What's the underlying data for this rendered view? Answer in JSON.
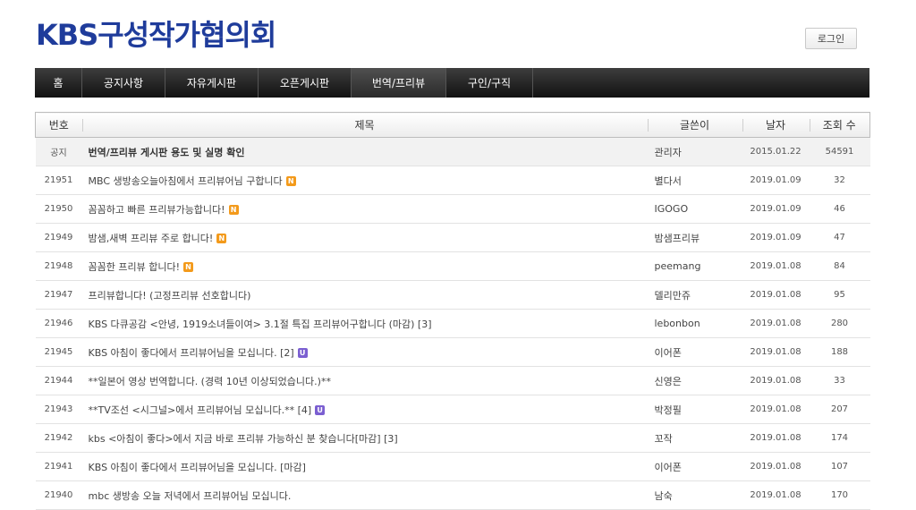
{
  "site": {
    "logo": "KBS구성작가협의회",
    "login_label": "로그인"
  },
  "colors": {
    "logo": "#1f3c9b",
    "nav_bg": "#1e1e1e",
    "badge_new": "#f39a1b",
    "badge_updated": "#7b5fd1"
  },
  "nav": {
    "items": [
      {
        "label": "홈"
      },
      {
        "label": "공지사항"
      },
      {
        "label": "자유게시판"
      },
      {
        "label": "오픈게시판"
      },
      {
        "label": "번역/프리뷰",
        "active": true
      },
      {
        "label": "구인/구직"
      }
    ]
  },
  "board": {
    "columns": {
      "number": "번호",
      "title": "제목",
      "writer": "글쓴이",
      "date": "날자",
      "views": "조회 수"
    },
    "rows": [
      {
        "number": "공지",
        "title": "번역/프리뷰 게시판 용도 및 실명 확인",
        "badge": "",
        "writer": "관리자",
        "date": "2015.01.22",
        "views": "54591",
        "notice": true
      },
      {
        "number": "21951",
        "title": "MBC 생방송오늘아침에서 프리뷰어님 구합니다",
        "badge": "N",
        "writer": "별다서",
        "date": "2019.01.09",
        "views": "32"
      },
      {
        "number": "21950",
        "title": "꼼꼼하고 빠른 프리뷰가능합니다!",
        "badge": "N",
        "writer": "IGOGO",
        "date": "2019.01.09",
        "views": "46"
      },
      {
        "number": "21949",
        "title": "밤샘,새벽 프리뷰 주로 합니다!",
        "badge": "N",
        "writer": "밤샘프리뷰",
        "date": "2019.01.09",
        "views": "47"
      },
      {
        "number": "21948",
        "title": "꼼꼼한 프리뷰 합니다!",
        "badge": "N",
        "writer": "peemang",
        "date": "2019.01.08",
        "views": "84"
      },
      {
        "number": "21947",
        "title": "프리뷰합니다! (고정프리뷰 선호합니다)",
        "badge": "",
        "writer": "델리만쥬",
        "date": "2019.01.08",
        "views": "95"
      },
      {
        "number": "21946",
        "title": "KBS 다큐공감 <안녕, 1919소녀들이여> 3.1절 특집 프리뷰어구합니다 (마감) [3]",
        "badge": "",
        "writer": "lebonbon",
        "date": "2019.01.08",
        "views": "280"
      },
      {
        "number": "21945",
        "title": "KBS 아침이 좋다에서 프리뷰어님을 모십니다.  [2]",
        "badge": "U",
        "writer": "이어폰",
        "date": "2019.01.08",
        "views": "188"
      },
      {
        "number": "21944",
        "title": "**일본어 영상 번역합니다. (경력 10년 이상되었습니다.)**",
        "badge": "",
        "writer": "신영은",
        "date": "2019.01.08",
        "views": "33"
      },
      {
        "number": "21943",
        "title": "**TV조선 <시그널>에서 프리뷰어님 모십니다.** [4]",
        "badge": "U",
        "writer": "박정필",
        "date": "2019.01.08",
        "views": "207"
      },
      {
        "number": "21942",
        "title": "kbs <아침이 좋다>에서 지금 바로 프리뷰 가능하신 분 찾습니다[마감] [3]",
        "badge": "",
        "writer": "꼬작",
        "date": "2019.01.08",
        "views": "174"
      },
      {
        "number": "21941",
        "title": "KBS 아침이 좋다에서 프리뷰어님을 모십니다. [마감]",
        "badge": "",
        "writer": "이어폰",
        "date": "2019.01.08",
        "views": "107"
      },
      {
        "number": "21940",
        "title": "mbc 생방송 오늘 저녁에서 프리뷰어님 모십니다.",
        "badge": "",
        "writer": "남숙",
        "date": "2019.01.08",
        "views": "170"
      }
    ]
  }
}
